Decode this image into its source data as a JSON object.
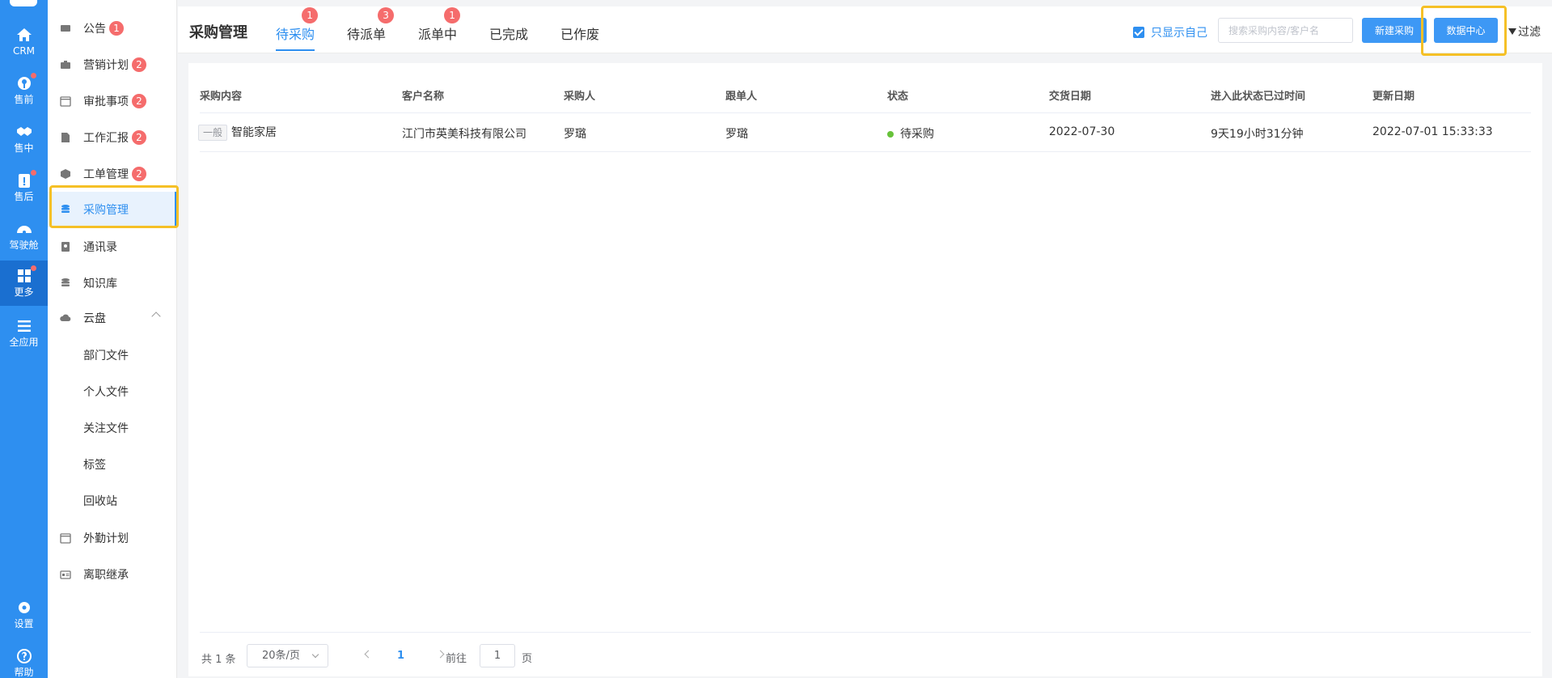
{
  "rail": {
    "items": [
      {
        "label": "CRM",
        "icon": "home-icon"
      },
      {
        "label": "售前",
        "icon": "pin-icon"
      },
      {
        "label": "售中",
        "icon": "handshake-icon"
      },
      {
        "label": "售后",
        "icon": "clipboard-icon"
      },
      {
        "label": "驾驶舱",
        "icon": "dashboard-icon"
      },
      {
        "label": "更多",
        "icon": "grid-icon"
      },
      {
        "label": "全应用",
        "icon": "menu-icon"
      },
      {
        "label": "设置",
        "icon": "gear-icon"
      },
      {
        "label": "帮助",
        "icon": "help-icon"
      }
    ]
  },
  "menu": {
    "items": [
      {
        "label": "公告",
        "badge": "1"
      },
      {
        "label": "营销计划",
        "badge": "2"
      },
      {
        "label": "审批事项",
        "badge": "2"
      },
      {
        "label": "工作汇报",
        "badge": "2"
      },
      {
        "label": "工单管理",
        "badge": "2"
      },
      {
        "label": "采购管理"
      },
      {
        "label": "通讯录"
      },
      {
        "label": "知识库"
      },
      {
        "label": "云盘"
      },
      {
        "label": "部门文件"
      },
      {
        "label": "个人文件"
      },
      {
        "label": "关注文件"
      },
      {
        "label": "标签"
      },
      {
        "label": "回收站"
      },
      {
        "label": "外勤计划"
      },
      {
        "label": "离职继承"
      }
    ]
  },
  "header": {
    "title": "采购管理",
    "tabs": [
      {
        "label": "待采购",
        "badge": "1"
      },
      {
        "label": "待派单",
        "badge": "3"
      },
      {
        "label": "派单中",
        "badge": "1"
      },
      {
        "label": "已完成"
      },
      {
        "label": "已作废"
      }
    ],
    "only_self_label": "只显示自己",
    "search_placeholder": "搜索采购内容/客户名",
    "new_button": "新建采购",
    "data_center_button": "数据中心",
    "filter_label": "过滤"
  },
  "table": {
    "columns": [
      "采购内容",
      "客户名称",
      "采购人",
      "跟单人",
      "状态",
      "交货日期",
      "进入此状态已过时间",
      "更新日期"
    ],
    "rows": [
      {
        "tag": "一般",
        "content": "智能家居",
        "customer": "江门市英美科技有限公司",
        "buyer": "罗璐",
        "follower": "罗璐",
        "status": "待采购",
        "delivery": "2022-07-30",
        "elapsed": "9天19小时31分钟",
        "updated": "2022-07-01 15:33:33"
      }
    ]
  },
  "pager": {
    "total": "共 1 条",
    "page_size": "20条/页",
    "current": "1",
    "goto_label": "前往",
    "goto_value": "1",
    "unit": "页"
  },
  "colors": {
    "accent": "#2e8ff0",
    "badge": "#f56c6c",
    "status_ok": "#67c23a",
    "highlight": "#f5c026"
  }
}
